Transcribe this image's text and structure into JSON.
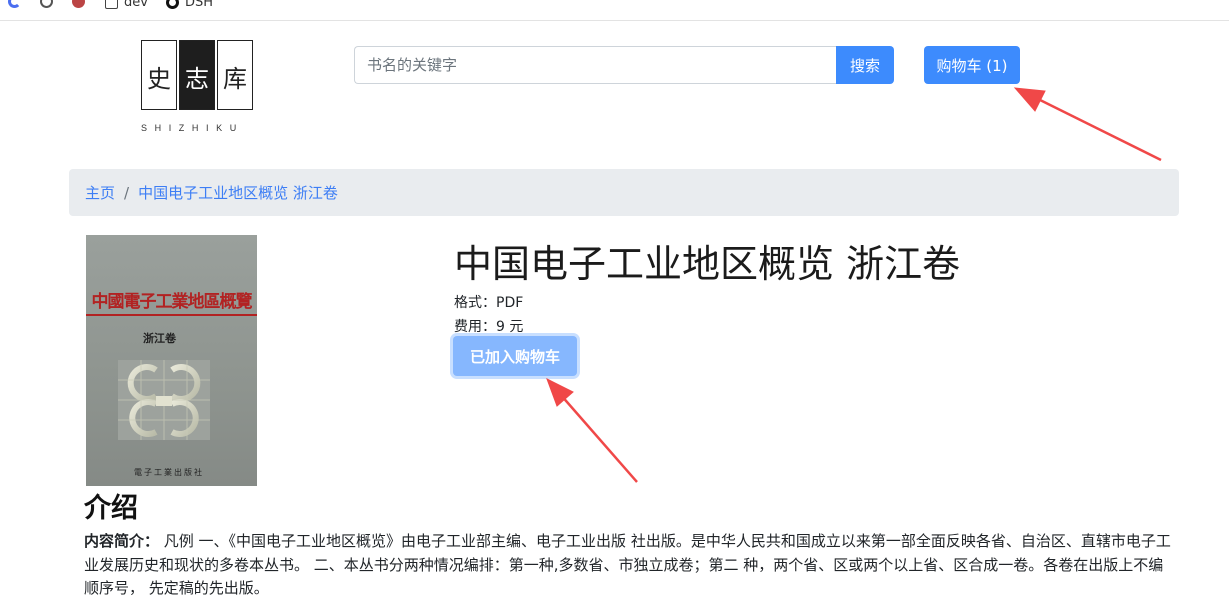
{
  "bookmarks": [
    {
      "label": "",
      "icon": "round-blue-icon"
    },
    {
      "label": "",
      "icon": "openai-icon"
    },
    {
      "label": "",
      "icon": "avatar-icon"
    },
    {
      "label": "dev",
      "icon": "folder-icon"
    },
    {
      "label": "DSH",
      "icon": "dsh-icon"
    }
  ],
  "logo": {
    "chars": [
      "史",
      "志",
      "库"
    ],
    "subtitle": "SHIZHIKU"
  },
  "search": {
    "placeholder": "书名的关键字",
    "button_label": "搜索"
  },
  "cart": {
    "label": "购物车 (1)"
  },
  "breadcrumb": {
    "home": "主页",
    "separator": "/",
    "current": "中国电子工业地区概览 浙江卷"
  },
  "cover": {
    "title": "中國電子工業地區概覽",
    "volume": "浙江卷",
    "publisher": "電子工業出版社"
  },
  "book": {
    "title": "中国电子工业地区概览 浙江卷",
    "format": "格式：PDF",
    "price": "费用：9 元",
    "added_label": "已加入购物车"
  },
  "intro": {
    "heading": "介绍",
    "label": "内容简介：",
    "text": " 凡例 一、《中国电子工业地区概览》由电子工业部主编、电子工业出版 社出版。是中华人民共和国成立以来第一部全面反映各省、自治区、直辖市电子工业发展历史和现状的多卷本丛书。 二、本丛书分两种情况编排：第一种,多数省、市独立成卷；第二 种，两个省、区或两个以上省、区合成一卷。各卷在出版上不编顺序号， 先定稿的先出版。"
  },
  "colors": {
    "primary": "#3d8bfd",
    "primary_disabled": "#86b7fe",
    "breadcrumb_bg": "#e9ecef",
    "link": "#3d7ef5",
    "annotation": "#f04848"
  }
}
